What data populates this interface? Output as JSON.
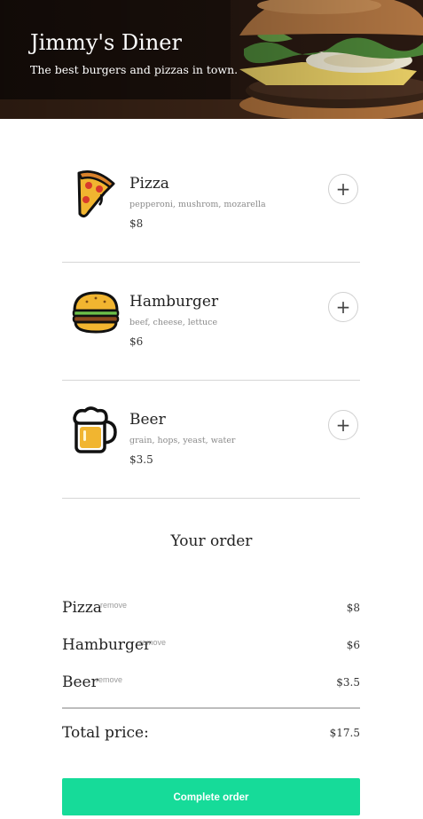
{
  "header": {
    "title": "Jimmy's Diner",
    "subtitle": "The best burgers and pizzas in town."
  },
  "menu": {
    "items": [
      {
        "name": "Pizza",
        "ingredients": "pepperoni, mushrom, mozarella",
        "price": "$8",
        "icon": "pizza-icon",
        "add_label": "+"
      },
      {
        "name": "Hamburger",
        "ingredients": "beef, cheese, lettuce",
        "price": "$6",
        "icon": "hamburger-icon",
        "add_label": "+"
      },
      {
        "name": "Beer",
        "ingredients": "grain, hops, yeast, water",
        "price": "$3.5",
        "icon": "beer-icon",
        "add_label": "+"
      }
    ]
  },
  "order": {
    "title": "Your order",
    "items": [
      {
        "name": "Pizza",
        "remove_label": "remove",
        "price": "$8"
      },
      {
        "name": "Hamburger",
        "remove_label": "remove",
        "price": "$6"
      },
      {
        "name": "Beer",
        "remove_label": "remove",
        "price": "$3.5"
      }
    ],
    "total_label": "Total price:",
    "total_value": "$17.5",
    "complete_label": "Complete order"
  },
  "colors": {
    "accent": "#16db99",
    "divider": "#d6d6d6"
  }
}
